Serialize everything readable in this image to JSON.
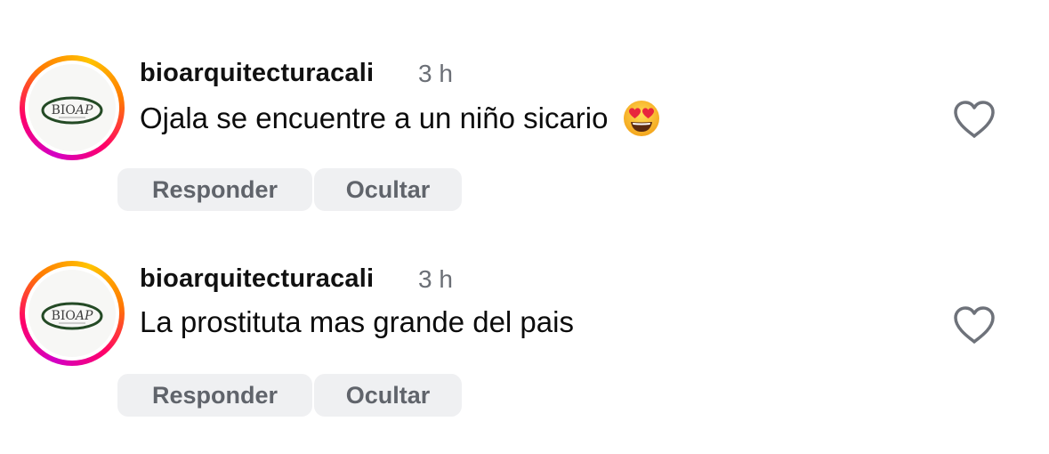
{
  "comments": [
    {
      "username": "bioarquitecturacali",
      "time": "3 h",
      "text": "Ojala se encuentre a un niño sicario",
      "emoji": "smiling-face-with-heart-eyes",
      "avatar_logo_text": "BIOAP",
      "actions": {
        "reply": "Responder",
        "hide": "Ocultar"
      }
    },
    {
      "username": "bioarquitecturacali",
      "time": "3 h",
      "text": "La prostituta mas grande del pais",
      "avatar_logo_text": "BIOAP",
      "actions": {
        "reply": "Responder",
        "hide": "Ocultar"
      }
    }
  ],
  "colors": {
    "username": "#111111",
    "time": "#6b6f76",
    "pill_bg": "#eff0f2",
    "pill_text": "#60646b",
    "heart_outline": "#6e727a"
  },
  "icons": {
    "like": "heart-outline-icon"
  }
}
